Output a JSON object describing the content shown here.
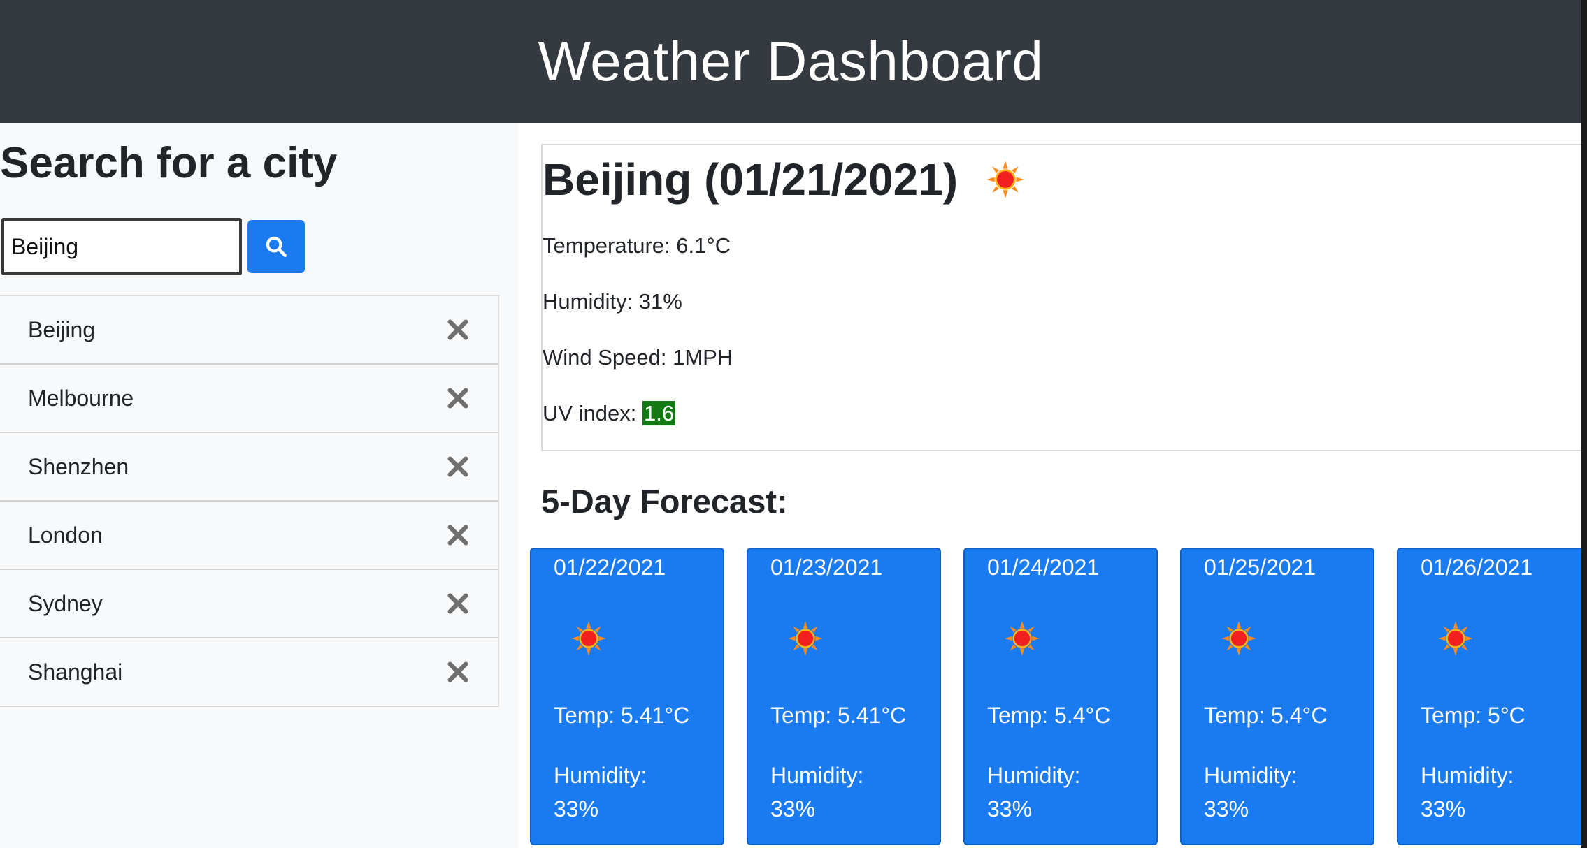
{
  "header": {
    "title": "Weather Dashboard"
  },
  "sidebar": {
    "heading": "Search for a city",
    "search": {
      "value": "Beijing",
      "placeholder": "",
      "button_icon": "search-icon"
    },
    "history": [
      {
        "city": "Beijing",
        "remove_icon": "close-icon"
      },
      {
        "city": "Melbourne",
        "remove_icon": "close-icon"
      },
      {
        "city": "Shenzhen",
        "remove_icon": "close-icon"
      },
      {
        "city": "London",
        "remove_icon": "close-icon"
      },
      {
        "city": "Sydney",
        "remove_icon": "close-icon"
      },
      {
        "city": "Shanghai",
        "remove_icon": "close-icon"
      }
    ]
  },
  "current": {
    "title": "Beijing (01/21/2021)",
    "icon": "sun-icon",
    "temperature_label": "Temperature: 6.1°C",
    "humidity_label": "Humidity: 31%",
    "wind_label": "Wind Speed: 1MPH",
    "uv_label": "UV index: ",
    "uv_value": "1.6",
    "uv_color": "#137a13"
  },
  "forecast": {
    "heading": "5-Day Forecast:",
    "days": [
      {
        "date": "01/22/2021",
        "icon": "sun-icon",
        "temp": "Temp: 5.41°C",
        "humidity_label": "Humidity:",
        "humidity_value": "33%"
      },
      {
        "date": "01/23/2021",
        "icon": "sun-icon",
        "temp": "Temp: 5.41°C",
        "humidity_label": "Humidity:",
        "humidity_value": "33%"
      },
      {
        "date": "01/24/2021",
        "icon": "sun-icon",
        "temp": "Temp: 5.4°C",
        "humidity_label": "Humidity:",
        "humidity_value": "33%"
      },
      {
        "date": "01/25/2021",
        "icon": "sun-icon",
        "temp": "Temp: 5.4°C",
        "humidity_label": "Humidity:",
        "humidity_value": "33%"
      },
      {
        "date": "01/26/2021",
        "icon": "sun-icon",
        "temp": "Temp: 5°C",
        "humidity_label": "Humidity:",
        "humidity_value": "33%"
      }
    ]
  },
  "colors": {
    "header_bg": "#343a40",
    "accent": "#1a7bf0",
    "sidebar_bg": "#f8f9fa"
  }
}
